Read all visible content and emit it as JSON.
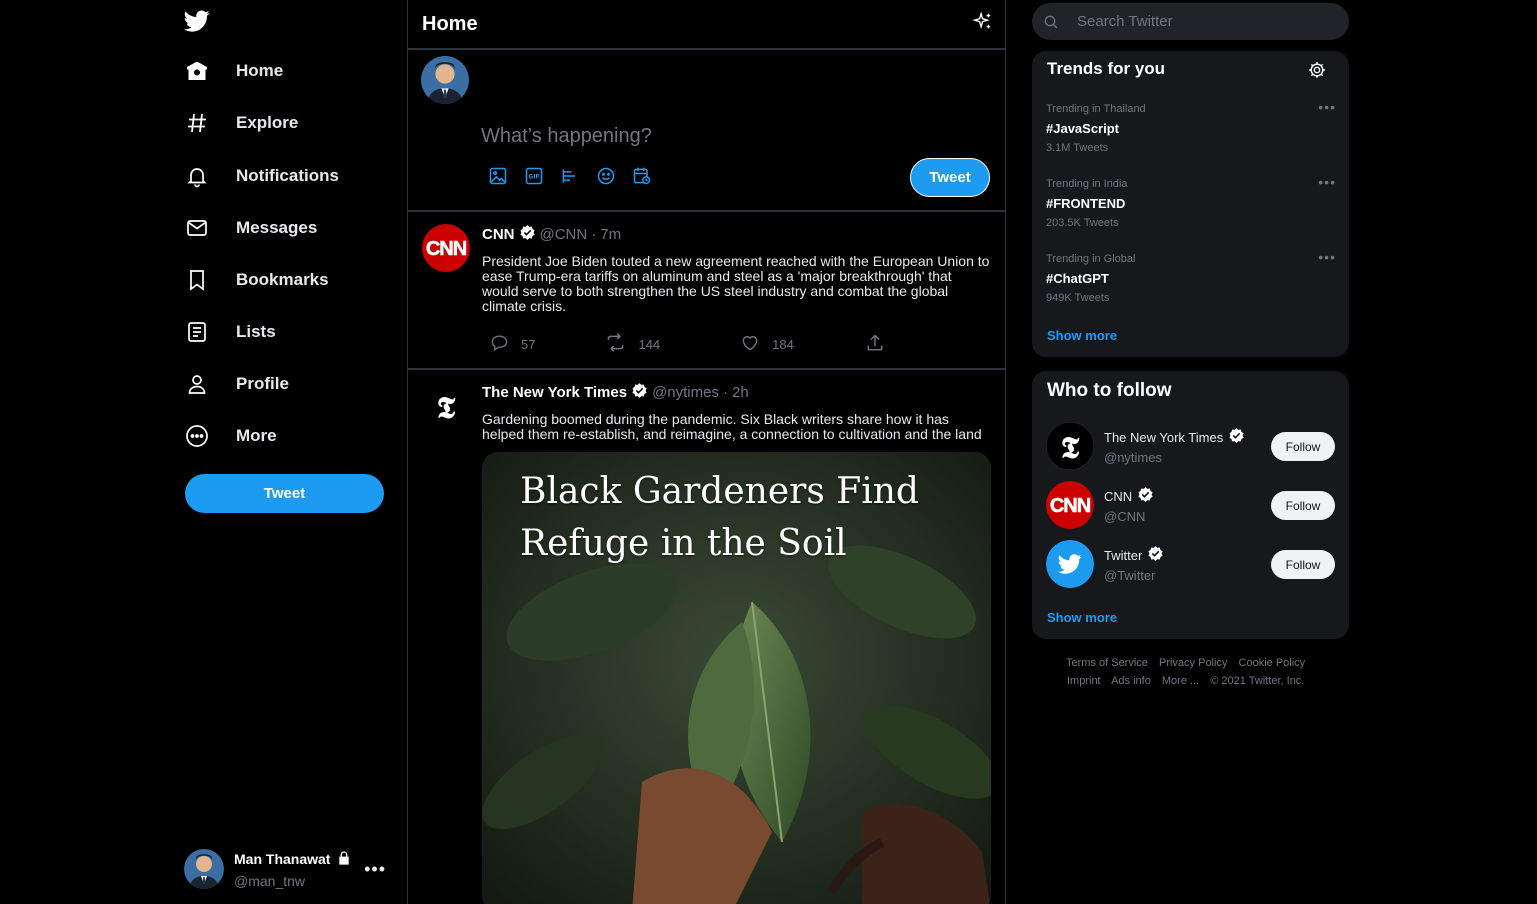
{
  "nav": {
    "items": [
      {
        "label": "Home",
        "icon": "home-icon"
      },
      {
        "label": "Explore",
        "icon": "hashtag-icon"
      },
      {
        "label": "Notifications",
        "icon": "bell-icon"
      },
      {
        "label": "Messages",
        "icon": "envelope-icon"
      },
      {
        "label": "Bookmarks",
        "icon": "bookmark-icon"
      },
      {
        "label": "Lists",
        "icon": "list-icon"
      },
      {
        "label": "Profile",
        "icon": "person-icon"
      },
      {
        "label": "More",
        "icon": "more-circle-icon"
      }
    ],
    "tweet_button": "Tweet"
  },
  "account": {
    "name": "Man Thanawat",
    "handle": "@man_tnw"
  },
  "header": {
    "title": "Home"
  },
  "compose": {
    "placeholder": "What’s happening?",
    "tweet_button": "Tweet"
  },
  "tweets": [
    {
      "name": "CNN",
      "handle": "@CNN",
      "dot": "·",
      "time": "7m",
      "text": "President Joe Biden touted a new agreement reached with the European Union to ease Trump-era tariffs on aluminum and steel as a 'major breakthrough' that would serve to both strengthen the US steel industry and combat the global climate crisis.",
      "replies": "57",
      "retweets": "144",
      "likes": "184"
    },
    {
      "name": "The New York Times",
      "handle": "@nytimes",
      "dot": "·",
      "time": "2h",
      "text": "Gardening boomed during the pandemic. Six Black writers share how it has helped them re-establish, and reimagine, a connection to cultivation and the land",
      "media_headline_1": "Black Gardeners Find",
      "media_headline_2": "Refuge in the Soil"
    }
  ],
  "search": {
    "placeholder": "Search Twitter"
  },
  "trends": {
    "title": "Trends for you",
    "items": [
      {
        "context": "Trending in Thailand",
        "tag": "#JavaScript",
        "count": "3.1M Tweets"
      },
      {
        "context": "Trending in India",
        "tag": "#FRONTEND",
        "count": "203.5K Tweets"
      },
      {
        "context": "Trending in Global",
        "tag": "#ChatGPT",
        "count": "949K Tweets"
      }
    ],
    "show_more": "Show more"
  },
  "who_to_follow": {
    "title": "Who to follow",
    "items": [
      {
        "name": "The New York Times",
        "handle": "@nytimes",
        "button": "Follow"
      },
      {
        "name": "CNN",
        "handle": "@CNN",
        "button": "Follow"
      },
      {
        "name": "Twitter",
        "handle": "@Twitter",
        "button": "Follow"
      }
    ],
    "show_more": "Show more"
  },
  "footer": {
    "links": [
      "Terms of Service",
      "Privacy Policy",
      "Cookie Policy",
      "Imprint",
      "Ads info",
      "More ...",
      "© 2021 Twitter, Inc."
    ]
  },
  "colors": {
    "accent": "#1d9bf0",
    "background": "#000000",
    "card": "#16181c",
    "muted": "#71767b",
    "cnn_red": "#cc0000"
  }
}
